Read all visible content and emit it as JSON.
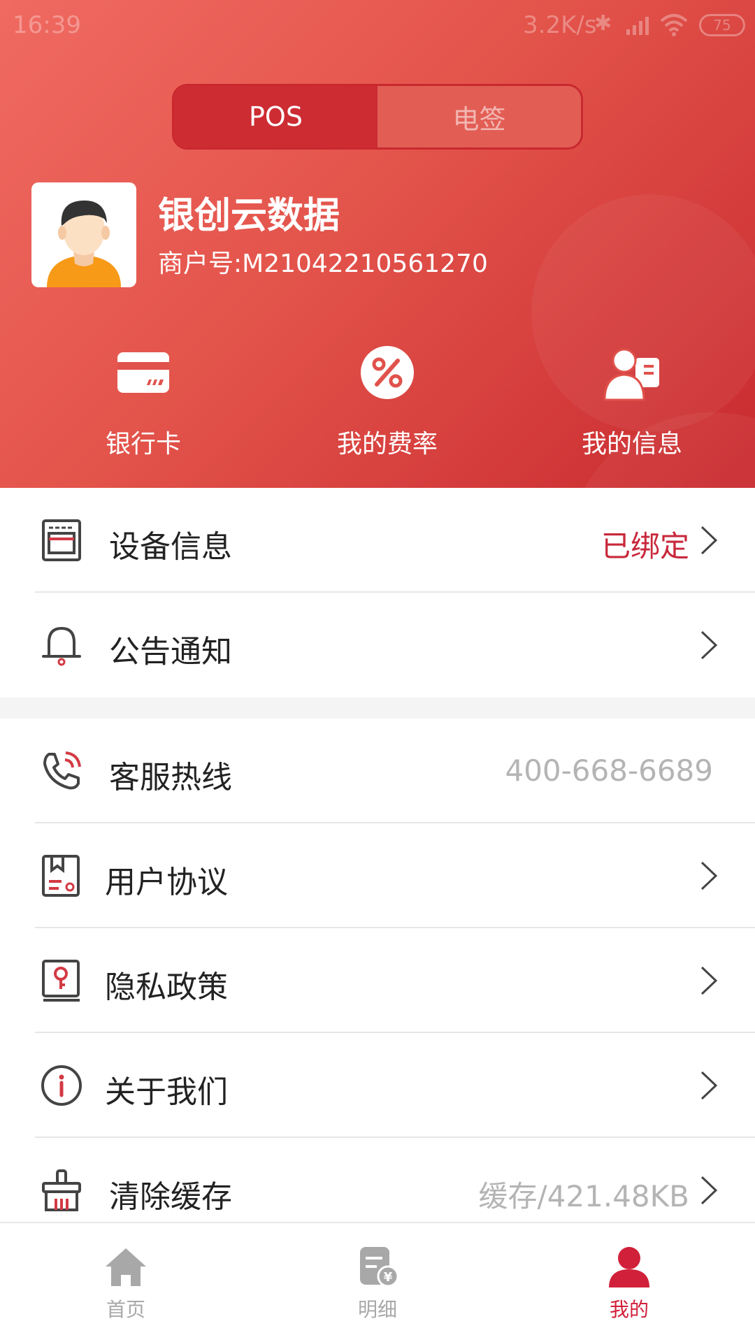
{
  "status_bar": {
    "time": "16:39",
    "network_speed": "3.2K/s",
    "battery": "75"
  },
  "segment": {
    "tabs": [
      {
        "label": "POS",
        "active": true
      },
      {
        "label": "电签",
        "active": false
      }
    ]
  },
  "merchant": {
    "name": "银创云数据",
    "id_text": "商户号:M21042210561270"
  },
  "quick_actions": [
    {
      "label": "银行卡",
      "icon": "bank-card-icon"
    },
    {
      "label": "我的费率",
      "icon": "percent-icon"
    },
    {
      "label": "我的信息",
      "icon": "user-info-icon"
    }
  ],
  "menu_group_1": [
    {
      "label": "设备信息",
      "value": "已绑定",
      "icon": "device-icon"
    },
    {
      "label": "公告通知",
      "value": "",
      "icon": "bell-icon"
    }
  ],
  "menu_group_2": [
    {
      "label": "客服热线",
      "value": "400-668-6689",
      "icon": "phone-icon"
    },
    {
      "label": "用户协议",
      "value": "",
      "icon": "agreement-icon"
    },
    {
      "label": "隐私政策",
      "value": "",
      "icon": "privacy-book-icon"
    },
    {
      "label": "关于我们",
      "value": "",
      "icon": "info-icon"
    },
    {
      "label": "清除缓存",
      "value": "缓存/421.48KB",
      "icon": "broom-icon"
    }
  ],
  "tab_bar": [
    {
      "label": "首页",
      "icon": "home-icon",
      "active": false
    },
    {
      "label": "明细",
      "icon": "bill-detail-icon",
      "active": false
    },
    {
      "label": "我的",
      "icon": "person-icon",
      "active": true
    }
  ],
  "colors": {
    "accent_red": "#cc2c32",
    "active_tab_red": "#d1213a",
    "muted_gray": "#b4b4b4"
  }
}
